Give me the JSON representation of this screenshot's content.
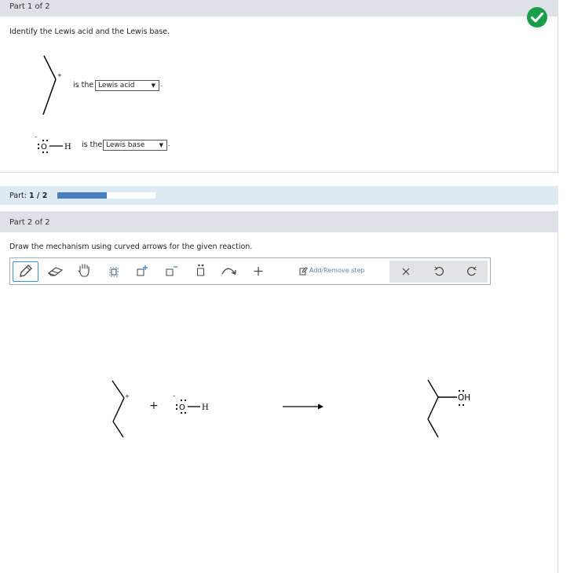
{
  "part1": {
    "header": "Part 1 of 2",
    "instruction": "Identify the Lewis acid and the Lewis base.",
    "row1": {
      "is_the": "is the",
      "selected": "Lewis acid"
    },
    "row2": {
      "is_the": "is the",
      "selected": "Lewis base"
    },
    "complete_icon": "check-circle-icon",
    "complete_color": "#1a9e4b"
  },
  "progress": {
    "label": "Part:",
    "value": "1 / 2",
    "fraction": 0.5,
    "bar_color": "#4a7fbf"
  },
  "part2": {
    "header": "Part 2 of 2",
    "instruction": "Draw the mechanism using curved arrows for the given reaction.",
    "toolbar": {
      "add_remove_step": "Add/Remove step",
      "tools": [
        "pencil-icon",
        "eraser-icon",
        "hand-icon",
        "select-box-icon",
        "positive-charge-icon",
        "negative-charge-icon",
        "lone-pair-icon",
        "curved-arrow-icon",
        "plus-icon"
      ],
      "actions": [
        "clear-icon",
        "undo-icon",
        "redo-icon"
      ]
    }
  },
  "chem": {
    "o_label": "O",
    "h_label": "H",
    "oh_label": "OH",
    "plus_sign": "+",
    "plus_charge": "+",
    "minus_charge": "–"
  }
}
